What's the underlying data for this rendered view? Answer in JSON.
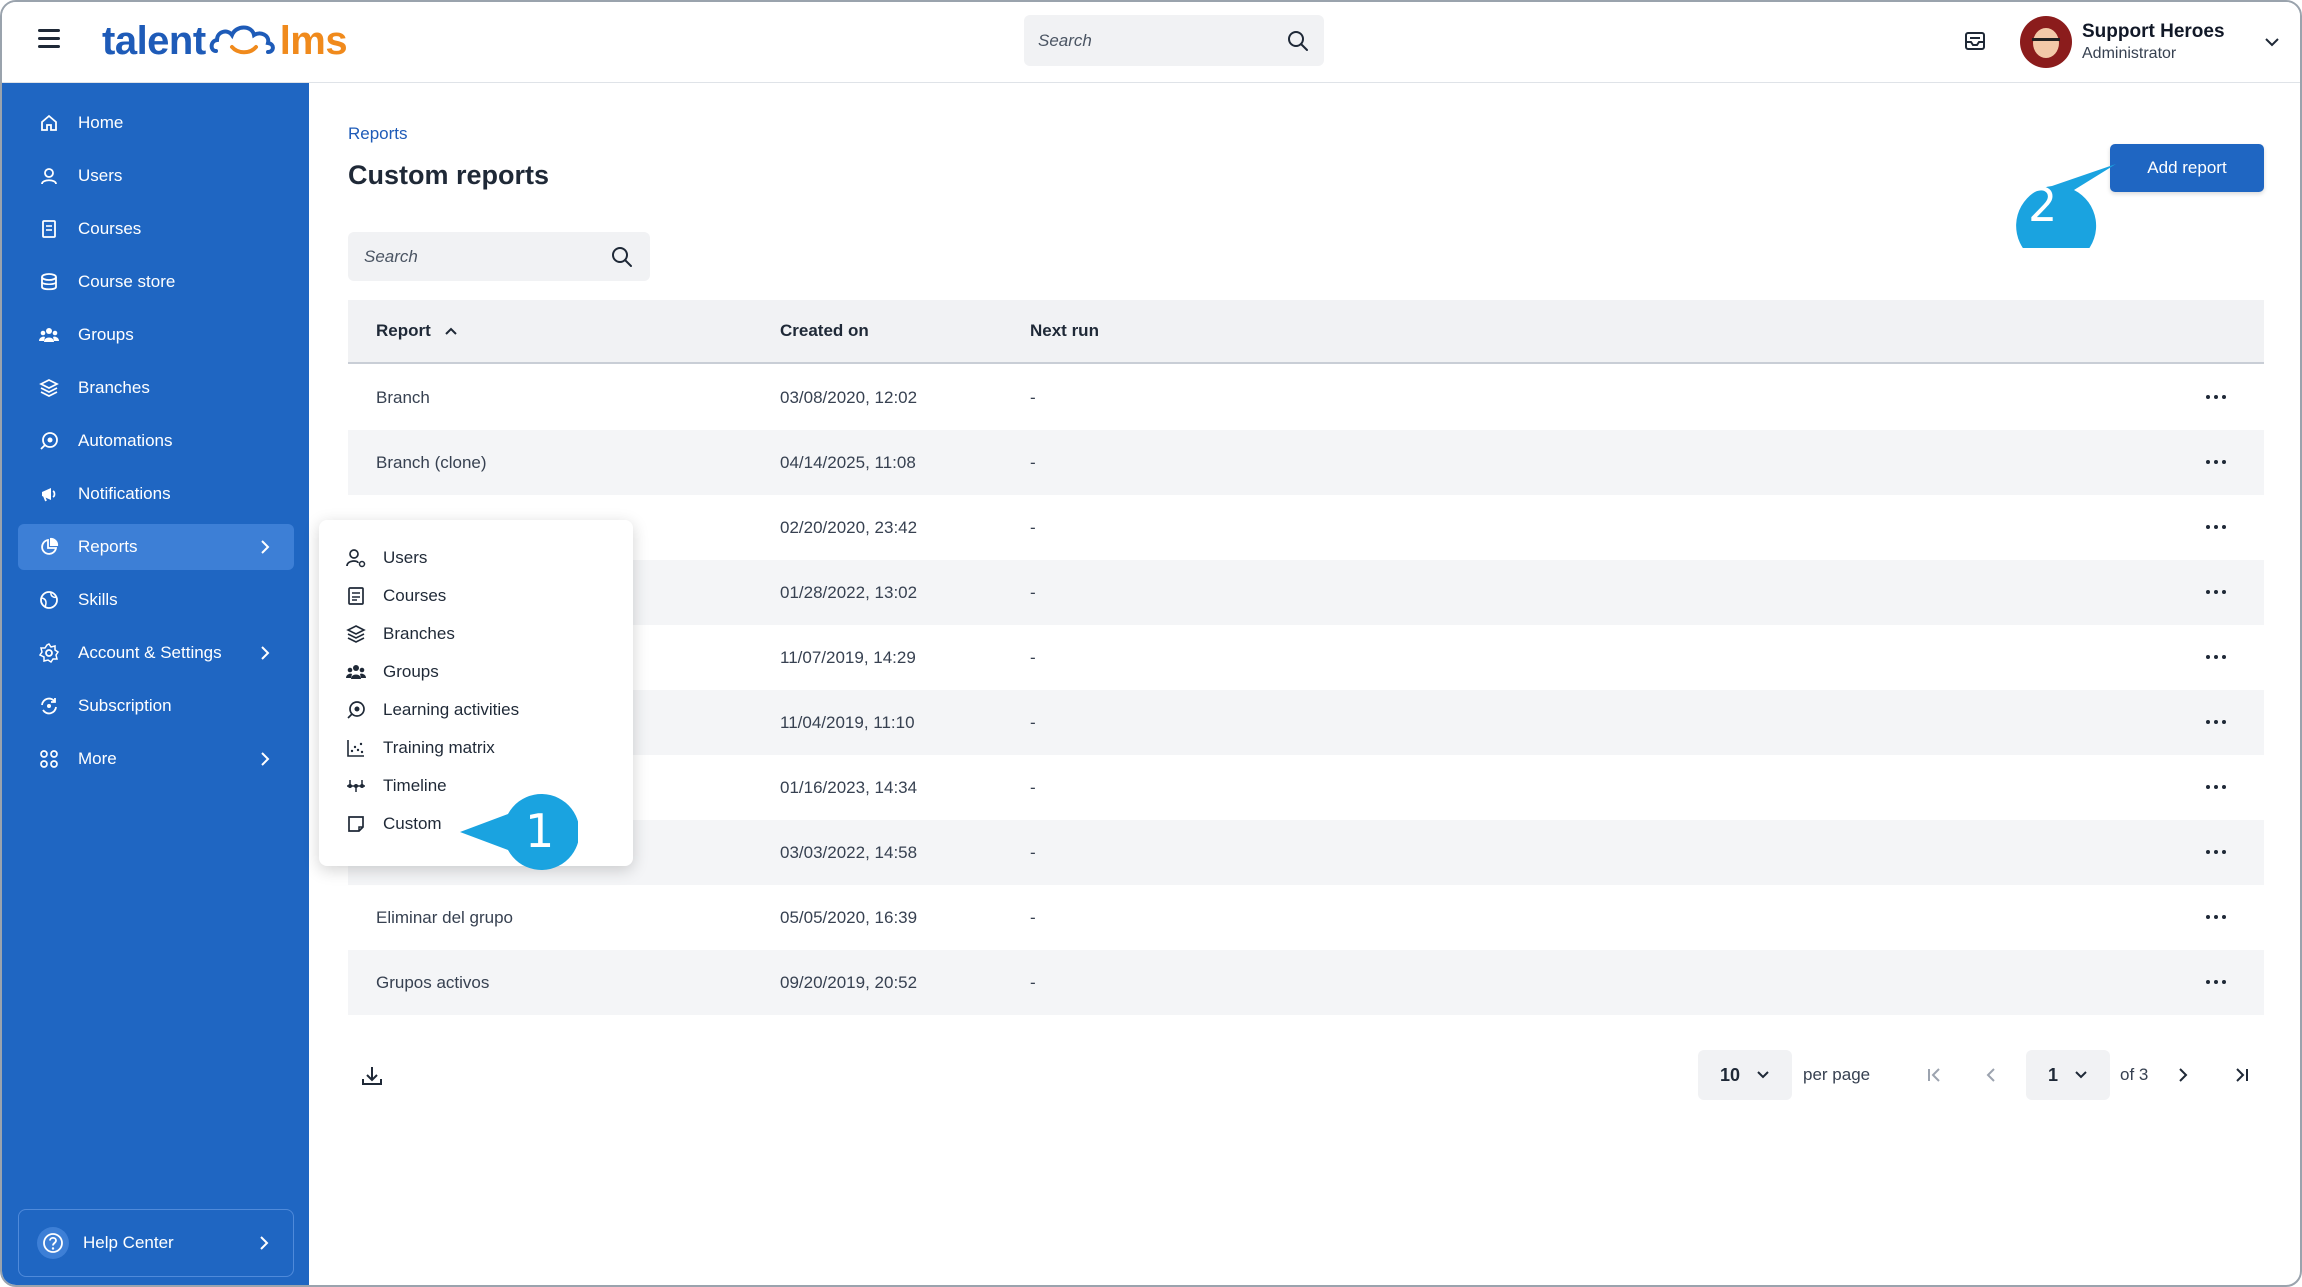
{
  "app": {
    "logo_left": "talent",
    "logo_right": "lms"
  },
  "top_search": {
    "placeholder": "Search"
  },
  "user": {
    "name": "Support Heroes",
    "role": "Administrator"
  },
  "sidebar": {
    "items": [
      {
        "label": "Home",
        "icon": "home-icon"
      },
      {
        "label": "Users",
        "icon": "user-icon"
      },
      {
        "label": "Courses",
        "icon": "book-icon"
      },
      {
        "label": "Course store",
        "icon": "store-icon"
      },
      {
        "label": "Groups",
        "icon": "groups-icon"
      },
      {
        "label": "Branches",
        "icon": "layers-icon"
      },
      {
        "label": "Automations",
        "icon": "automation-icon"
      },
      {
        "label": "Notifications",
        "icon": "megaphone-icon"
      },
      {
        "label": "Reports",
        "icon": "pie-chart-icon"
      },
      {
        "label": "Skills",
        "icon": "globe-icon"
      },
      {
        "label": "Account & Settings",
        "icon": "gear-icon"
      },
      {
        "label": "Subscription",
        "icon": "refresh-icon"
      },
      {
        "label": "More",
        "icon": "grid-icon"
      }
    ],
    "help": "Help Center"
  },
  "reports_menu": [
    "Users",
    "Courses",
    "Branches",
    "Groups",
    "Learning activities",
    "Training matrix",
    "Timeline",
    "Custom"
  ],
  "page": {
    "breadcrumb": "Reports",
    "title": "Custom reports",
    "add_button": "Add report",
    "search_placeholder": "Search"
  },
  "table": {
    "headers": {
      "report": "Report",
      "created": "Created on",
      "next": "Next run"
    },
    "rows": [
      {
        "report": "Branch",
        "created": "03/08/2020, 12:02",
        "next": "-"
      },
      {
        "report": "Branch (clone)",
        "created": "04/14/2025, 11:08",
        "next": "-"
      },
      {
        "report": "",
        "created": "02/20/2020, 23:42",
        "next": "-"
      },
      {
        "report": "",
        "created": "01/28/2022, 13:02",
        "next": "-"
      },
      {
        "report": "",
        "created": "11/07/2019, 14:29",
        "next": "-"
      },
      {
        "report": "",
        "created": "11/04/2019, 11:10",
        "next": "-"
      },
      {
        "report": "",
        "created": "01/16/2023, 14:34",
        "next": "-"
      },
      {
        "report": "",
        "created": "03/03/2022, 14:58",
        "next": "-"
      },
      {
        "report": "Eliminar del grupo",
        "created": "05/05/2020, 16:39",
        "next": "-"
      },
      {
        "report": "Grupos activos",
        "created": "09/20/2019, 20:52",
        "next": "-"
      }
    ]
  },
  "pagination": {
    "per_page_value": "10",
    "per_page_label": "per page",
    "current_page": "1",
    "of_label": "of 3"
  },
  "callouts": {
    "first": "1",
    "second": "2"
  },
  "colors": {
    "sidebar": "#1f66c2",
    "active": "#3d7fd6",
    "accent": "#1e5bb8",
    "brand_orange": "#f08a1c",
    "callout": "#1aa3e0"
  }
}
